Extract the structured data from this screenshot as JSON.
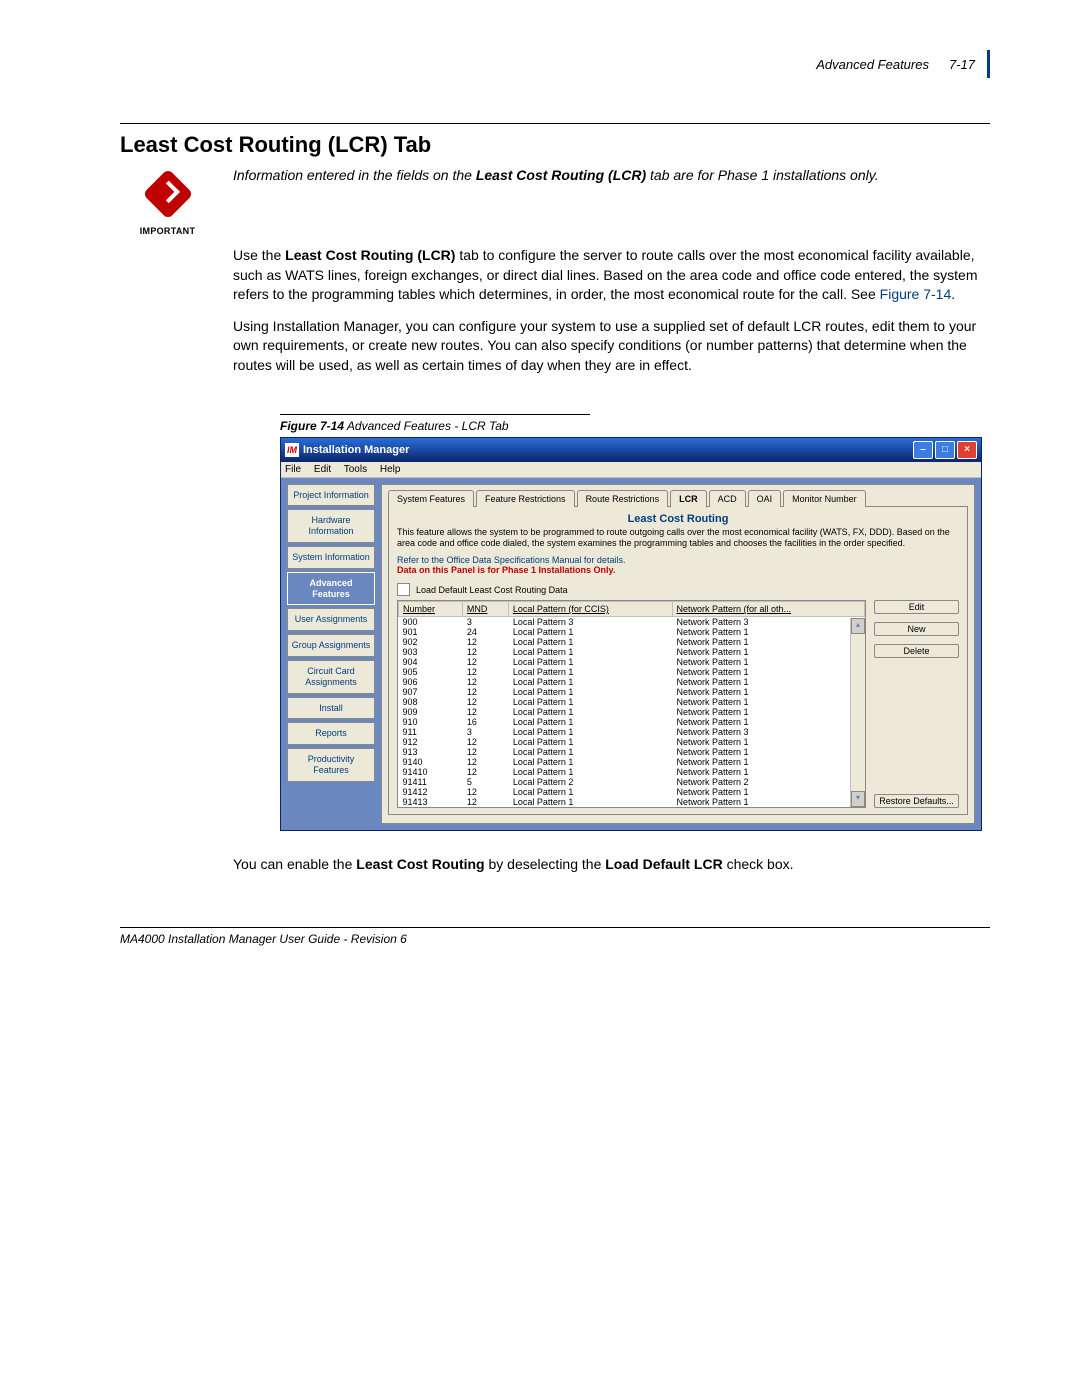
{
  "header": {
    "section": "Advanced Features",
    "page": "7-17"
  },
  "title": "Least Cost Routing (LCR) Tab",
  "important_label": "IMPORTANT",
  "intro_italic_prefix": "Information entered in the fields on the ",
  "intro_italic_bold": "Least Cost Routing (LCR)",
  "intro_italic_suffix": " tab are for Phase 1 installations only.",
  "para1a": "Use the ",
  "para1_bold": "Least Cost Routing (LCR)",
  "para1b": " tab to configure the server to route calls over the most economical facility available, such as WATS lines, foreign exchanges, or direct dial lines. Based on the area code and office code entered, the system refers to the programming tables which determines, in order, the most economical route for the call. See ",
  "para1_figref": "Figure 7-14",
  "para1c": ".",
  "para2": "Using Installation Manager, you can configure your system to use a supplied set of default LCR routes, edit them to your own requirements, or create new routes. You can also specify conditions (or number patterns) that determine when the routes will be used, as well as certain times of day when they are in effect.",
  "figure_caption_label": "Figure 7-14",
  "figure_caption_text": "  Advanced Features - LCR Tab",
  "window": {
    "title": "Installation Manager",
    "menus": [
      "File",
      "Edit",
      "Tools",
      "Help"
    ],
    "sidebar": [
      "Project Information",
      "Hardware Information",
      "System Information",
      "Advanced Features",
      "User Assignments",
      "Group Assignments",
      "Circuit Card Assignments",
      "Install",
      "Reports",
      "Productivity Features"
    ],
    "sidebar_active_index": 3,
    "tabs": [
      "System Features",
      "Feature Restrictions",
      "Route Restrictions",
      "LCR",
      "ACD",
      "OAI",
      "Monitor Number"
    ],
    "tabs_active_index": 3,
    "panel_title": "Least Cost Routing",
    "panel_desc": "This feature allows the system to be programmed to route outgoing calls over the most economical facility (WATS, FX, DDD). Based on the area code and office code dialed, the system examines the programming tables and chooses the facilities in the order specified.",
    "panel_note1": "Refer to the Office Data Specifications Manual for details.",
    "panel_note2": "Data on this Panel is for Phase 1 Installations Only.",
    "checkbox_label": "Load Default Least Cost Routing Data",
    "columns": [
      "Number",
      "MND",
      "Local Pattern (for CCIS)",
      "Network Pattern (for all oth..."
    ],
    "rows": [
      [
        "900",
        "3",
        "Local Pattern 3",
        "Network Pattern 3"
      ],
      [
        "901",
        "24",
        "Local Pattern 1",
        "Network Pattern 1"
      ],
      [
        "902",
        "12",
        "Local Pattern 1",
        "Network Pattern 1"
      ],
      [
        "903",
        "12",
        "Local Pattern 1",
        "Network Pattern 1"
      ],
      [
        "904",
        "12",
        "Local Pattern 1",
        "Network Pattern 1"
      ],
      [
        "905",
        "12",
        "Local Pattern 1",
        "Network Pattern 1"
      ],
      [
        "906",
        "12",
        "Local Pattern 1",
        "Network Pattern 1"
      ],
      [
        "907",
        "12",
        "Local Pattern 1",
        "Network Pattern 1"
      ],
      [
        "908",
        "12",
        "Local Pattern 1",
        "Network Pattern 1"
      ],
      [
        "909",
        "12",
        "Local Pattern 1",
        "Network Pattern 1"
      ],
      [
        "910",
        "16",
        "Local Pattern 1",
        "Network Pattern 1"
      ],
      [
        "911",
        "3",
        "Local Pattern 1",
        "Network Pattern 3"
      ],
      [
        "912",
        "12",
        "Local Pattern 1",
        "Network Pattern 1"
      ],
      [
        "913",
        "12",
        "Local Pattern 1",
        "Network Pattern 1"
      ],
      [
        "9140",
        "12",
        "Local Pattern 1",
        "Network Pattern 1"
      ],
      [
        "91410",
        "12",
        "Local Pattern 1",
        "Network Pattern 1"
      ],
      [
        "91411",
        "5",
        "Local Pattern 2",
        "Network Pattern 2"
      ],
      [
        "91412",
        "12",
        "Local Pattern 1",
        "Network Pattern 1"
      ],
      [
        "91413",
        "12",
        "Local Pattern 1",
        "Network Pattern 1"
      ]
    ],
    "buttons": {
      "edit": "Edit",
      "new": "New",
      "delete": "Delete",
      "restore": "Restore Defaults..."
    }
  },
  "para3a": "You can enable the ",
  "para3_bold1": "Least Cost Routing",
  "para3b": " by deselecting the ",
  "para3_bold2": "Load Default LCR",
  "para3c": " check box.",
  "footer": "MA4000 Installation Manager User Guide - Revision 6"
}
